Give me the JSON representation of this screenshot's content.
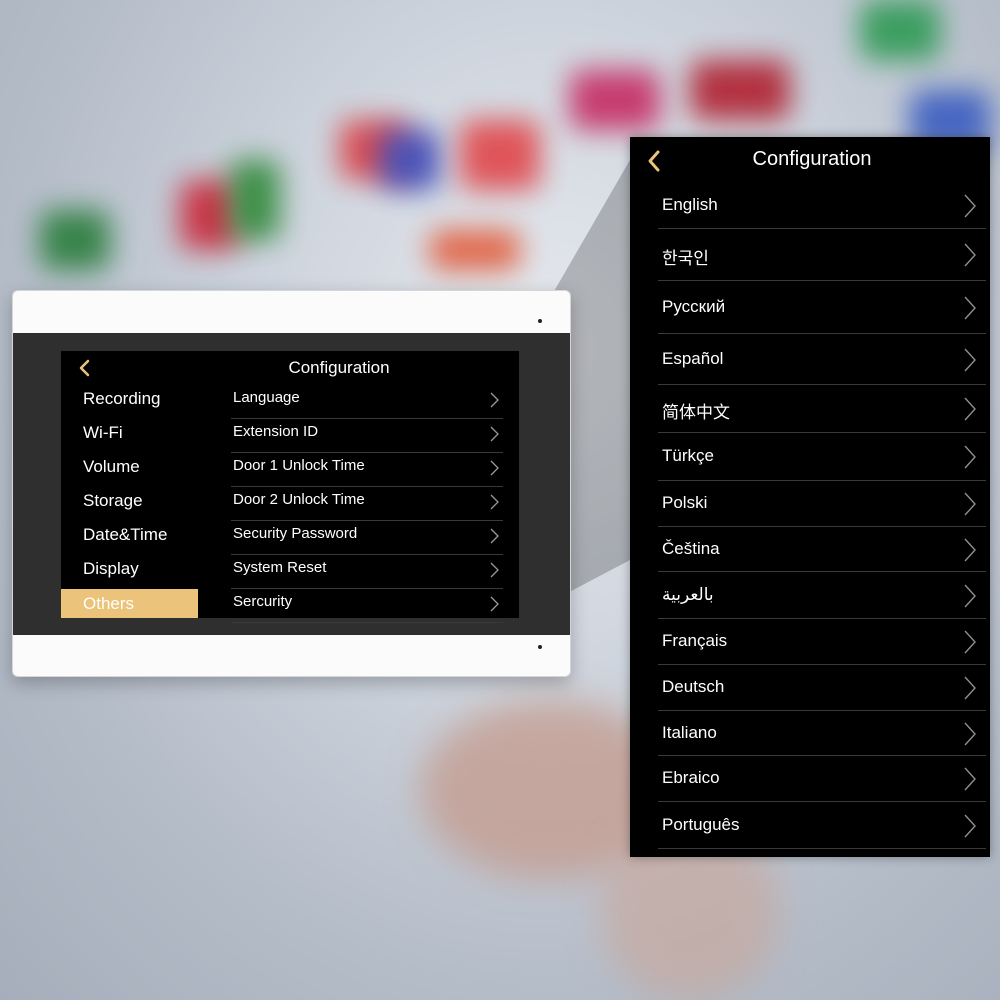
{
  "device_screen": {
    "title": "Configuration",
    "back_icon": "chevron-left-icon",
    "accent_color": "#ebc37a",
    "menu": [
      {
        "label": "Recording",
        "active": false
      },
      {
        "label": "Wi-Fi",
        "active": false
      },
      {
        "label": "Volume",
        "active": false
      },
      {
        "label": "Storage",
        "active": false
      },
      {
        "label": "Date&Time",
        "active": false
      },
      {
        "label": "Display",
        "active": false
      },
      {
        "label": "Others",
        "active": true
      }
    ],
    "settings": [
      {
        "label": "Language"
      },
      {
        "label": "Extension ID"
      },
      {
        "label": "Door 1 Unlock Time"
      },
      {
        "label": "Door 2 Unlock Time"
      },
      {
        "label": "Security Password"
      },
      {
        "label": "System Reset"
      },
      {
        "label": "Sercurity"
      }
    ]
  },
  "language_panel": {
    "title": "Configuration",
    "back_icon": "chevron-left-icon",
    "row_icon": "chevron-right-icon",
    "languages": [
      {
        "label": "English"
      },
      {
        "label": "한국인"
      },
      {
        "label": "Русский"
      },
      {
        "label": "Español"
      },
      {
        "label": "简体中文"
      },
      {
        "label": "Türkçe"
      },
      {
        "label": "Polski"
      },
      {
        "label": "Čeština"
      },
      {
        "label": "بالعربية"
      },
      {
        "label": "Français"
      },
      {
        "label": "Deutsch"
      },
      {
        "label": "Italiano"
      },
      {
        "label": "Ebraico"
      },
      {
        "label": "Português"
      }
    ]
  }
}
